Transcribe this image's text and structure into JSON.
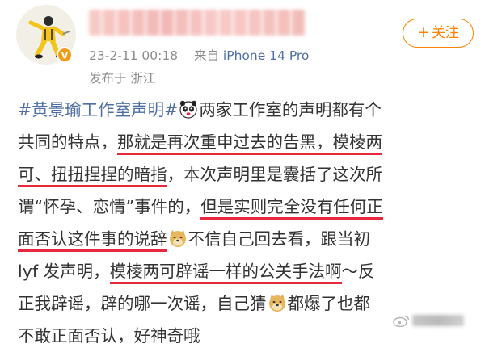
{
  "header": {
    "timestamp": "23-2-11 00:18",
    "source_prefix": "来自",
    "device": "iPhone 14 Pro",
    "location_line": "发布于 浙江",
    "follow_label": "关注",
    "follow_plus": "+"
  },
  "post": {
    "line1": {
      "hashtag": "#黄景瑜工作室声明#",
      "text": "两家工作室的声明都有个"
    },
    "line2": {
      "a": "共同的特点，",
      "u": "那就是再次重申过去的告黑，模棱两"
    },
    "line3": {
      "u": "可、扭扭捏捏的暗指",
      "b": "，本次声明里是囊括了这次所"
    },
    "line4": {
      "a": "谓“怀孕、恋情”事件的，",
      "u": "但是实则完全没有任何正"
    },
    "line5": {
      "u": "面否认这件事的说辞",
      "b": "不信自己回去看，跟当初"
    },
    "line6": {
      "a": "lyf 发声明，",
      "u": "模棱两可辟谣一样的公关手法啊",
      "b": "～反"
    },
    "line7": {
      "a": "正我辟谣，辟的哪一次谣，自己猜",
      "b": "都爆了也都"
    },
    "line8": {
      "a": "不敢正面否认，好神奇哦"
    }
  },
  "icons": {
    "avatar": "avatar-icon",
    "verified": "verified-badge-icon",
    "panda_emoji": "panda-emoji-icon",
    "doge_emoji": "doge-emoji-icon",
    "weibo": "weibo-logo-icon"
  },
  "colors": {
    "accent": "#ff8200",
    "link": "#4f6fa3",
    "underline": "#e8283d",
    "meta": "#8c8c8c"
  }
}
